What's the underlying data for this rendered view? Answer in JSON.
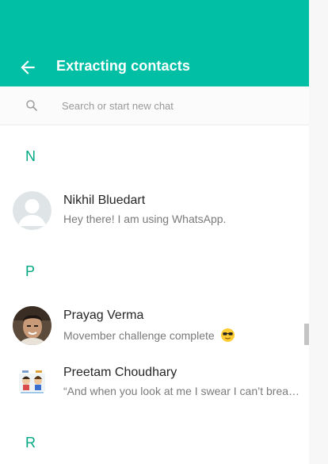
{
  "header": {
    "title": "Extracting contacts",
    "back_icon": "arrow-left-icon",
    "background_color": "#00bfa5"
  },
  "search": {
    "icon": "search-icon",
    "placeholder": "Search or start new chat",
    "value": ""
  },
  "sections": [
    {
      "letter": "N",
      "contacts": [
        {
          "name": "Nikhil Bluedart",
          "status": "Hey there! I am using WhatsApp.",
          "avatar": "default-avatar"
        }
      ]
    },
    {
      "letter": "P",
      "contacts": [
        {
          "name": "Prayag Verma",
          "status": "Movember challenge complete",
          "status_emoji": "sunglasses-emoji",
          "avatar": "photo-avatar"
        },
        {
          "name": "Preetam Choudhary",
          "status": "“And when you look at me I swear I can’t breathe…",
          "avatar": "cartoon-avatar"
        }
      ]
    },
    {
      "letter": "R",
      "contacts": []
    }
  ],
  "colors": {
    "accent": "#00a884",
    "name_text": "#262626",
    "status_text": "#7a7a7a"
  }
}
